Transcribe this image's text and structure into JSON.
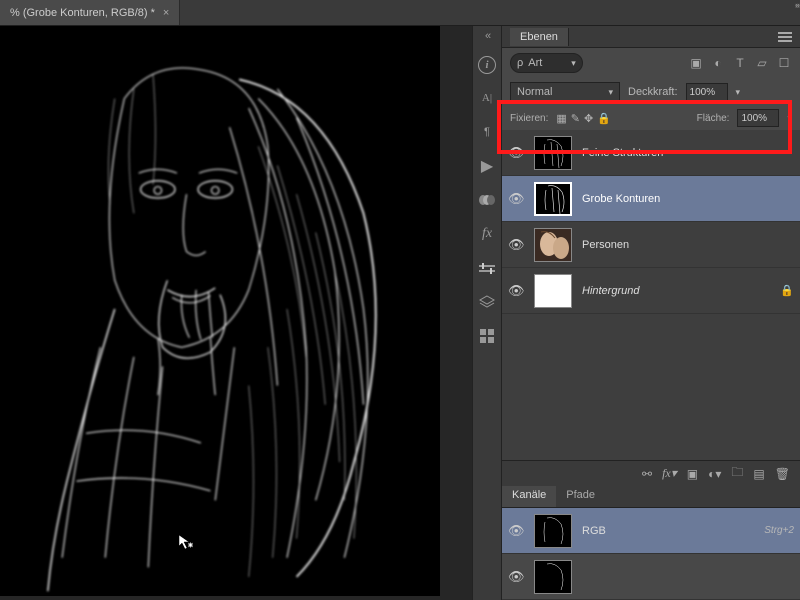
{
  "tab": {
    "title": "% (Grobe Konturen, RGB/8) *"
  },
  "panels": {
    "ebenen": {
      "title": "Ebenen",
      "filterPrefix": "ρ",
      "filterLabel": "Art",
      "blendMode": "Normal",
      "opacityLabel": "Deckkraft:",
      "opacityValue": "100%",
      "fillLabel": "Fläche:",
      "fillValue": "100%",
      "lockLabel": "Fixieren:"
    },
    "layers": [
      {
        "name": "Feine Strukturen",
        "type": "edge"
      },
      {
        "name": "Grobe Konturen",
        "type": "edge",
        "active": true
      },
      {
        "name": "Personen",
        "type": "photo"
      },
      {
        "name": "Hintergrund",
        "type": "white",
        "locked": true,
        "italic": true
      }
    ],
    "channels": {
      "tab1": "Kanäle",
      "tab2": "Pfade",
      "rows": [
        {
          "name": "RGB",
          "shortcut": "Strg+2",
          "sel": true
        }
      ]
    }
  }
}
